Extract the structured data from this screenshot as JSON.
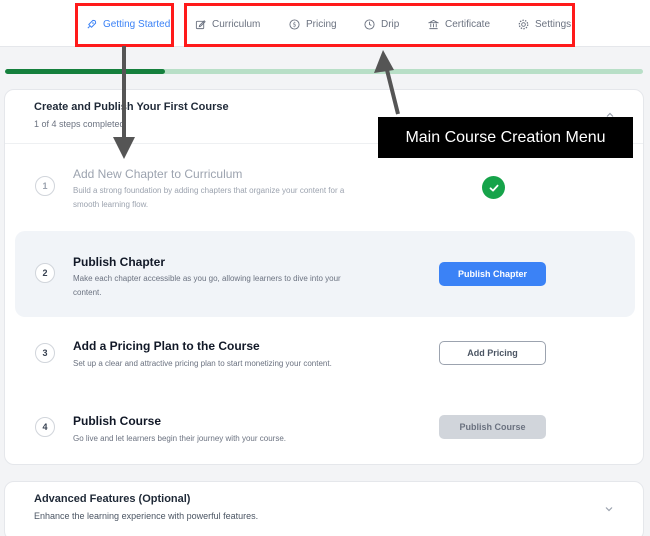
{
  "nav": {
    "tabs": [
      {
        "label": "Getting Started",
        "icon": "rocket-icon",
        "active": true
      },
      {
        "label": "Curriculum",
        "icon": "edit-icon",
        "active": false
      },
      {
        "label": "Pricing",
        "icon": "dollar-icon",
        "active": false
      },
      {
        "label": "Drip",
        "icon": "clock-icon",
        "active": false
      },
      {
        "label": "Certificate",
        "icon": "certificate-icon",
        "active": false
      },
      {
        "label": "Settings",
        "icon": "gear-icon",
        "active": false
      }
    ]
  },
  "progress": {
    "fraction": 0.25,
    "fill_color": "#15803d",
    "track_color": "#b8dfc7"
  },
  "card": {
    "title": "Create and Publish Your First Course",
    "subtitle": "1 of 4 steps completed",
    "steps": [
      {
        "number": "1",
        "title": "Add New Chapter to Curriculum",
        "description": "Build a strong foundation by adding chapters that organize your content for a smooth learning flow.",
        "status": "completed"
      },
      {
        "number": "2",
        "title": "Publish Chapter",
        "description": "Make each chapter accessible as you go, allowing learners to dive into your content.",
        "button": "Publish Chapter"
      },
      {
        "number": "3",
        "title": "Add a Pricing Plan to the Course",
        "description": "Set up a clear and attractive pricing plan to start monetizing your content.",
        "button": "Add Pricing"
      },
      {
        "number": "4",
        "title": "Publish Course",
        "description": "Go live and let learners begin their journey with your course.",
        "button": "Publish Course"
      }
    ]
  },
  "advanced": {
    "title": "Advanced Features (Optional)",
    "subtitle": "Enhance the learning experience with powerful features."
  },
  "annotation": {
    "label": "Main Course Creation Menu",
    "box_color": "#ff1a1a"
  },
  "colors": {
    "accent": "#3b82f6",
    "success": "#16a34a"
  }
}
